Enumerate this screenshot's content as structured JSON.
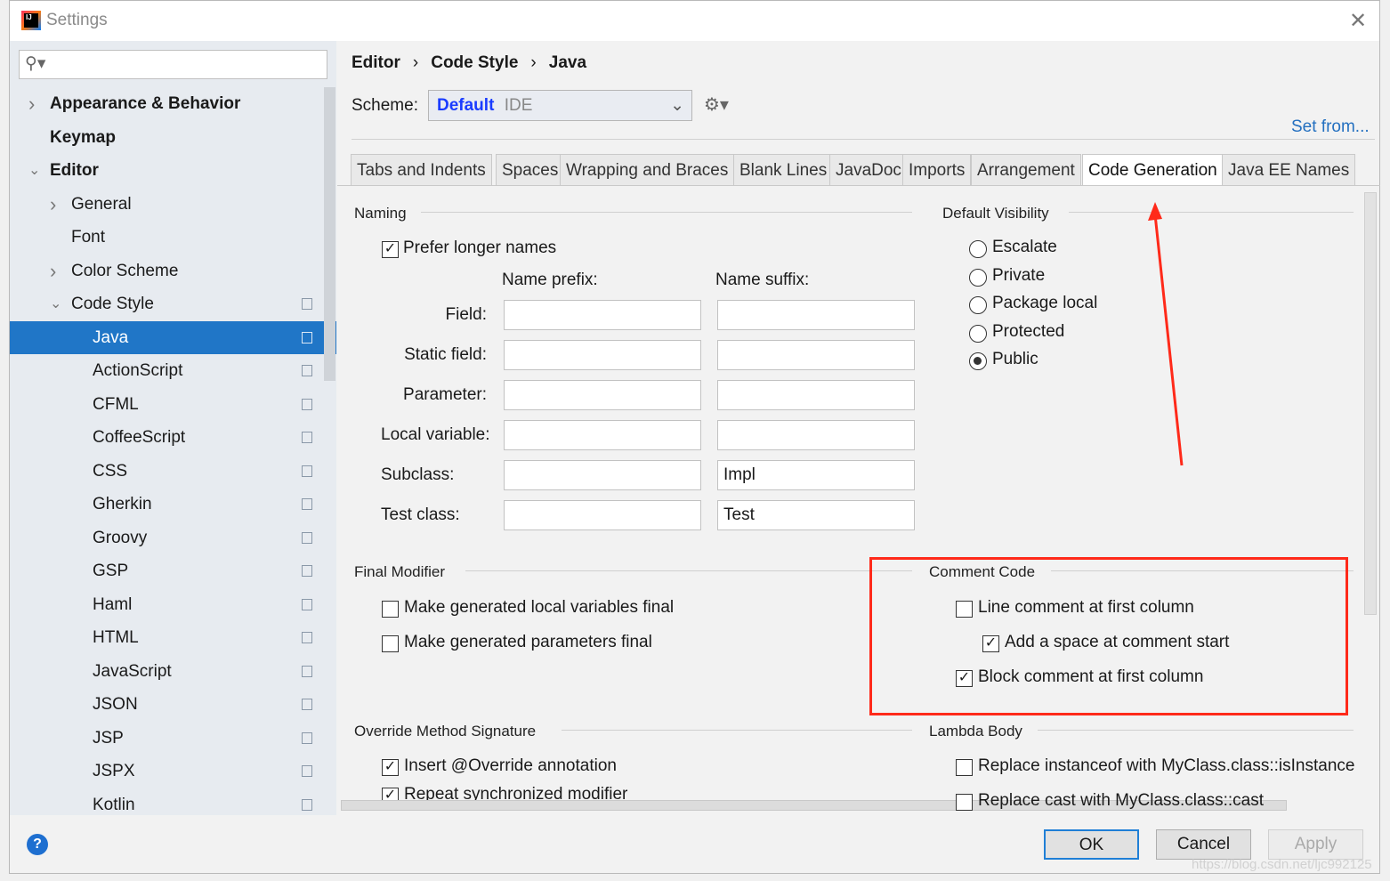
{
  "window": {
    "title": "Settings",
    "logo": "IJ"
  },
  "search": {
    "placeholder": "",
    "value": ""
  },
  "sidebar": {
    "items": [
      {
        "label": "Appearance & Behavior",
        "bold": true,
        "chevron": "right"
      },
      {
        "label": "Keymap",
        "bold": true
      },
      {
        "label": "Editor",
        "bold": true,
        "chevron": "down"
      },
      {
        "label": "General",
        "chevron": "right"
      },
      {
        "label": "Font"
      },
      {
        "label": "Color Scheme",
        "chevron": "right"
      },
      {
        "label": "Code Style",
        "chevron": "down",
        "copy": true
      },
      {
        "label": "Java",
        "selected": true,
        "copy": true
      },
      {
        "label": "ActionScript",
        "copy": true
      },
      {
        "label": "CFML",
        "copy": true
      },
      {
        "label": "CoffeeScript",
        "copy": true
      },
      {
        "label": "CSS",
        "copy": true
      },
      {
        "label": "Gherkin",
        "copy": true
      },
      {
        "label": "Groovy",
        "copy": true
      },
      {
        "label": "GSP",
        "copy": true
      },
      {
        "label": "Haml",
        "copy": true
      },
      {
        "label": "HTML",
        "copy": true
      },
      {
        "label": "JavaScript",
        "copy": true
      },
      {
        "label": "JSON",
        "copy": true
      },
      {
        "label": "JSP",
        "copy": true
      },
      {
        "label": "JSPX",
        "copy": true
      },
      {
        "label": "Kotlin",
        "copy": true
      }
    ]
  },
  "breadcrumb": [
    "Editor",
    "Code Style",
    "Java"
  ],
  "scheme": {
    "label": "Scheme:",
    "value": "Default",
    "scope": "IDE",
    "set_from": "Set from..."
  },
  "tabs": [
    "Tabs and Indents",
    "Spaces",
    "Wrapping and Braces",
    "Blank Lines",
    "JavaDoc",
    "Imports",
    "Arrangement",
    "Code Generation",
    "Java EE Names"
  ],
  "active_tab": "Code Generation",
  "naming": {
    "title": "Naming",
    "prefer_longer": {
      "label": "Prefer longer names",
      "checked": true
    },
    "prefix_header": "Name prefix:",
    "suffix_header": "Name suffix:",
    "rows": [
      {
        "label": "Field:",
        "prefix": "",
        "suffix": ""
      },
      {
        "label": "Static field:",
        "prefix": "",
        "suffix": ""
      },
      {
        "label": "Parameter:",
        "prefix": "",
        "suffix": ""
      },
      {
        "label": "Local variable:",
        "prefix": "",
        "suffix": ""
      },
      {
        "label": "Subclass:",
        "prefix": "",
        "suffix": "Impl"
      },
      {
        "label": "Test class:",
        "prefix": "",
        "suffix": "Test"
      }
    ]
  },
  "visibility": {
    "title": "Default Visibility",
    "options": [
      "Escalate",
      "Private",
      "Package local",
      "Protected",
      "Public"
    ],
    "selected": "Public"
  },
  "final_modifier": {
    "title": "Final Modifier",
    "items": [
      {
        "label": "Make generated local variables final",
        "checked": false
      },
      {
        "label": "Make generated parameters final",
        "checked": false
      }
    ]
  },
  "comment_code": {
    "title": "Comment Code",
    "items": [
      {
        "label": "Line comment at first column",
        "checked": false
      },
      {
        "label": "Add a space at comment start",
        "checked": true
      },
      {
        "label": "Block comment at first column",
        "checked": true
      }
    ]
  },
  "override": {
    "title": "Override Method Signature",
    "items": [
      {
        "label": "Insert @Override annotation",
        "checked": true
      },
      {
        "label": "Repeat synchronized modifier",
        "checked": true
      }
    ]
  },
  "lambda": {
    "title": "Lambda Body",
    "items": [
      {
        "label": "Replace instanceof with MyClass.class::isInstance",
        "checked": false
      },
      {
        "label": "Replace cast with MyClass.class::cast",
        "checked": false
      }
    ]
  },
  "buttons": {
    "ok": "OK",
    "cancel": "Cancel",
    "apply": "Apply",
    "help": "?"
  },
  "watermark": "https://blog.csdn.net/ljc992125",
  "colors": {
    "selection": "#2076c7",
    "annotation": "#ff2a1a",
    "link": "#2470c0",
    "scheme_value": "#1a3cff"
  }
}
